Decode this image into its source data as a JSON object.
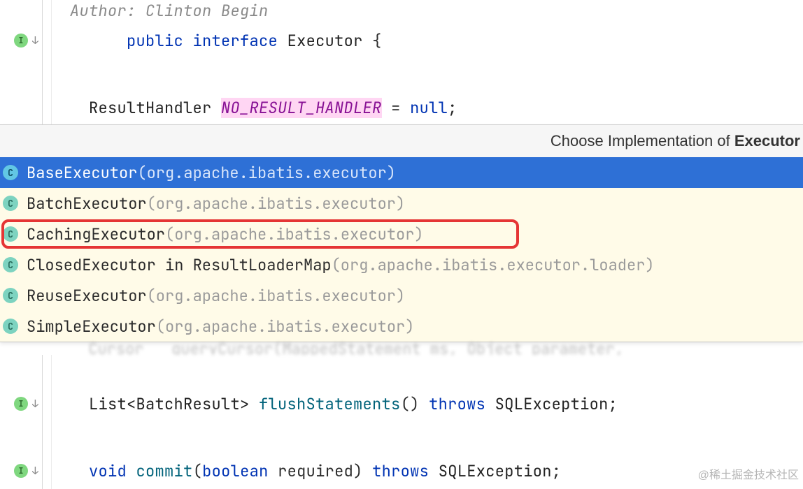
{
  "author_comment": "Author: Clinton Begin",
  "interface_decl": {
    "kw_public": "public",
    "kw_interface": "interface",
    "name": "Executor",
    "brace": "{"
  },
  "field_line": {
    "type": "ResultHandler",
    "name": "NO_RESULT_HANDLER",
    "eq": "=",
    "value": "null",
    "semi": ";"
  },
  "popup": {
    "title_prefix": "Choose Implementation of ",
    "title_target": "Executor",
    "items": [
      {
        "name": "BaseExecutor",
        "pkg": "(org.apache.ibatis.executor)",
        "selected": true,
        "highlighted": false
      },
      {
        "name": "BatchExecutor",
        "pkg": "(org.apache.ibatis.executor)",
        "selected": false,
        "highlighted": false
      },
      {
        "name": "CachingExecutor",
        "pkg": "(org.apache.ibatis.executor)",
        "selected": false,
        "highlighted": true
      },
      {
        "name": "ClosedExecutor in ResultLoaderMap",
        "pkg": "(org.apache.ibatis.executor.loader)",
        "selected": false,
        "highlighted": false
      },
      {
        "name": "ReuseExecutor",
        "pkg": "(org.apache.ibatis.executor)",
        "selected": false,
        "highlighted": false
      },
      {
        "name": "SimpleExecutor",
        "pkg": "(org.apache.ibatis.executor)",
        "selected": false,
        "highlighted": false
      }
    ]
  },
  "obscured_text": "  Cursor   queryCursor(MappedStatement ms, Object parameter,",
  "flush_line": {
    "return_type": "List<BatchResult>",
    "method": "flushStatements",
    "parens": "()",
    "kw_throws": "throws",
    "exception": "SQLException",
    "semi": ";"
  },
  "commit_line": {
    "kw_void": "void",
    "method": "commit",
    "paren_l": "(",
    "param_type": "boolean",
    "param_name": "required",
    "paren_r": ")",
    "kw_throws": "throws",
    "exception": "SQLException",
    "semi": ";"
  },
  "watermark": "@稀土掘金技术社区",
  "icon_glyphs": {
    "interface_letter": "I",
    "class_letter": "C"
  }
}
